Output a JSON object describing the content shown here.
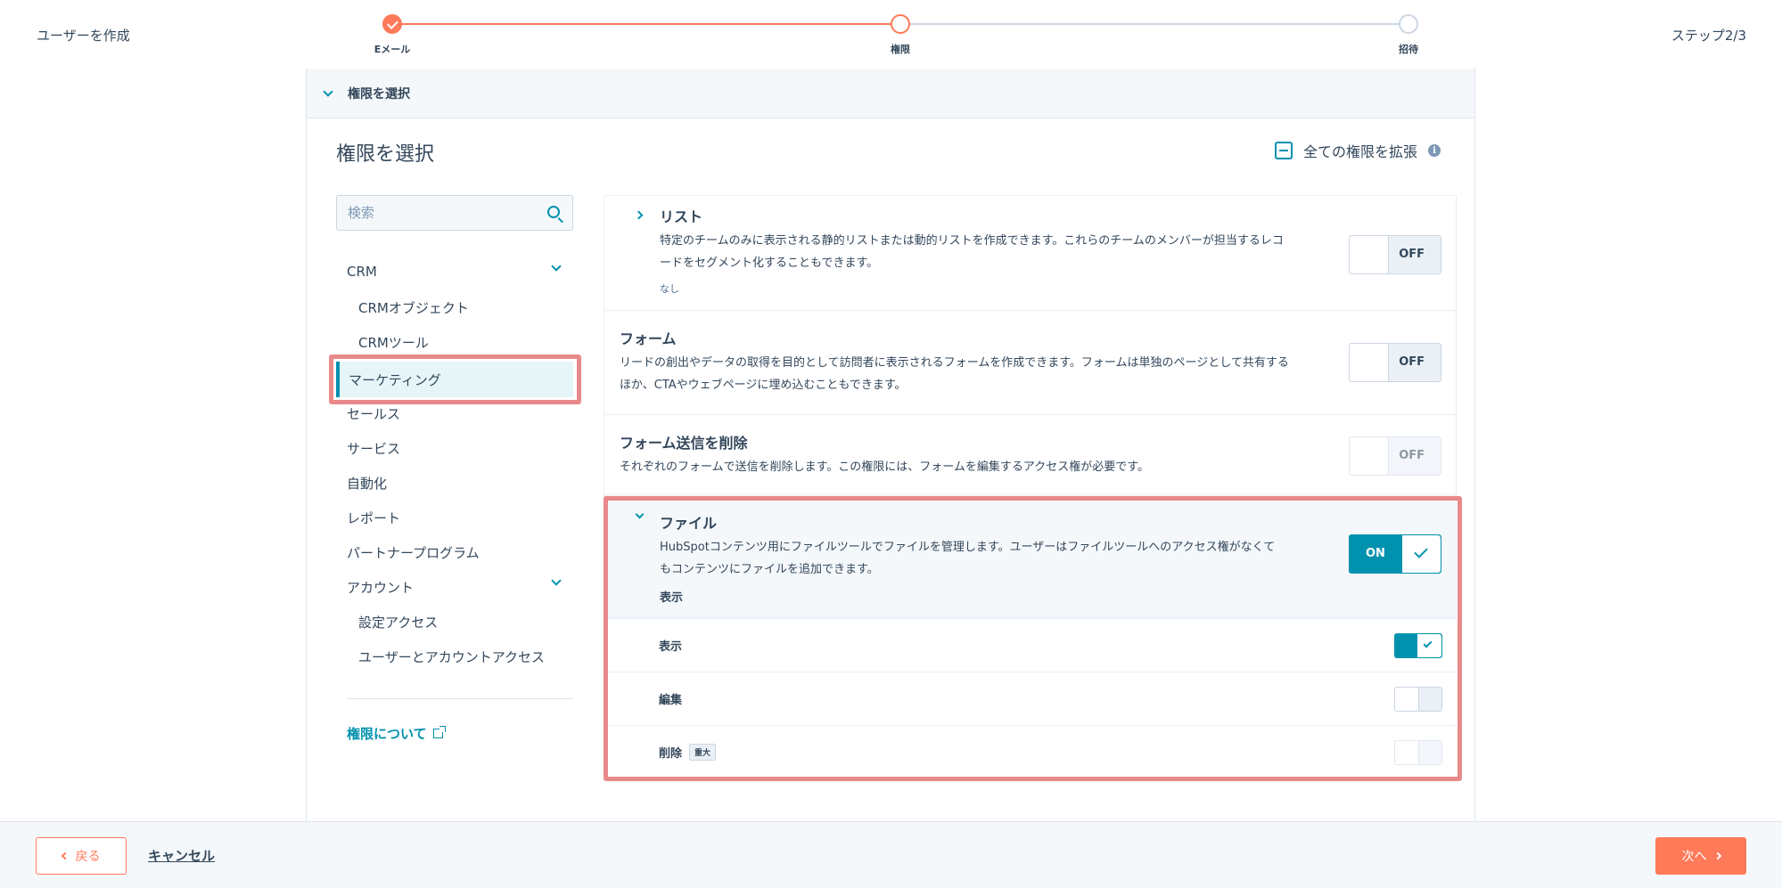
{
  "header": {
    "title": "ユーザーを作成",
    "step_counter": "ステップ2/3",
    "steps": [
      {
        "label": "Eメール",
        "state": "done"
      },
      {
        "label": "権限",
        "state": "current"
      },
      {
        "label": "招待",
        "state": "todo"
      }
    ]
  },
  "section": {
    "collapse_label": "権限を選択",
    "panel_title": "権限を選択",
    "expand_all": "全ての権限を拡張"
  },
  "sidebar": {
    "search_placeholder": "検索",
    "items": [
      {
        "label": "CRM",
        "expandable": true
      },
      {
        "label": "CRMオブジェクト"
      },
      {
        "label": "CRMツール"
      },
      {
        "label": "マーケティング",
        "active": true
      },
      {
        "label": "セールス"
      },
      {
        "label": "サービス"
      },
      {
        "label": "自動化"
      },
      {
        "label": "レポート"
      },
      {
        "label": "パートナープログラム"
      },
      {
        "label": "アカウント",
        "expandable": true
      },
      {
        "label": "設定アクセス"
      },
      {
        "label": "ユーザーとアカウントアクセス"
      }
    ],
    "about_link": "権限について"
  },
  "permissions": {
    "list": {
      "title": "リスト",
      "desc": "特定のチームのみに表示される静的リストまたは動的リストを作成できます。これらのチームのメンバーが担当するレコードをセグメント化することもできます。",
      "sub": "なし",
      "toggle": "OFF"
    },
    "form": {
      "title": "フォーム",
      "desc": "リードの創出やデータの取得を目的として訪問者に表示されるフォームを作成できます。フォームは単独のページとして共有するほか、CTAやウェブページに埋め込むこともできます。",
      "toggle": "OFF"
    },
    "form_delete": {
      "title": "フォーム送信を削除",
      "desc": "それぞれのフォームで送信を削除します。この権限には、フォームを編集するアクセス権が必要です。",
      "toggle": "OFF"
    },
    "file": {
      "title": "ファイル",
      "desc": "HubSpotコンテンツ用にファイルツールでファイルを管理します。ユーザーはファイルツールへのアクセス権がなくてもコンテンツにファイルを追加できます。",
      "sub": "表示",
      "toggle": "ON",
      "subs": [
        {
          "label": "表示",
          "on": true
        },
        {
          "label": "編集",
          "on": false
        },
        {
          "label": "削除",
          "badge": "重大",
          "on": false
        }
      ]
    }
  },
  "footer": {
    "back": "戻る",
    "cancel": "キャンセル",
    "next": "次へ"
  },
  "colors": {
    "accent": "#0091ae",
    "primary": "#ff7a59",
    "highlight": "#e8898a"
  }
}
